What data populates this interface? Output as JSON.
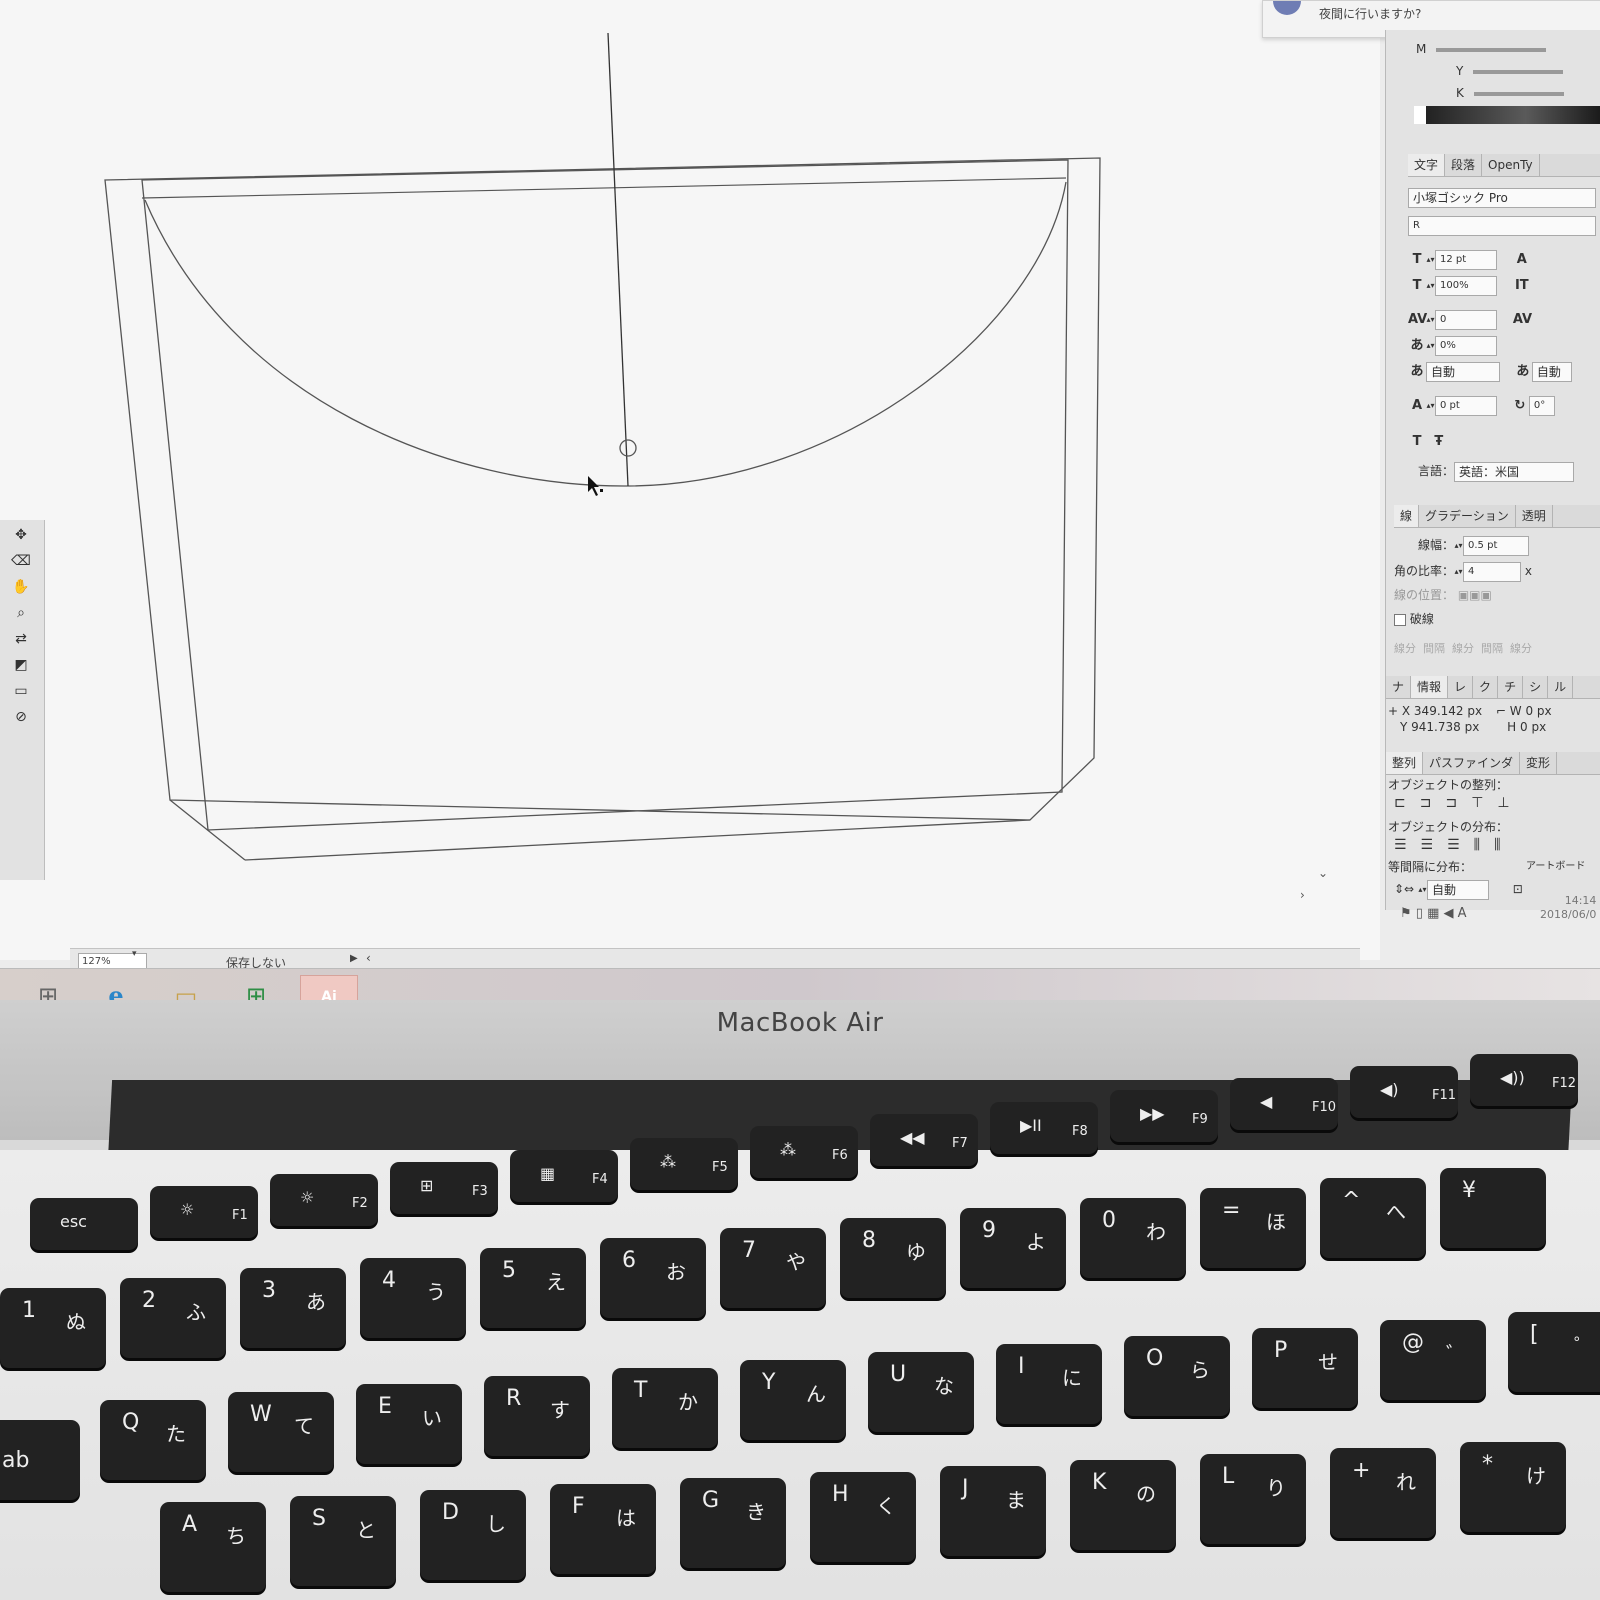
{
  "notification": {
    "text": "夜間に行いますか?"
  },
  "toolbox": {
    "icons": [
      "selection-icon",
      "hand-icon",
      "zoom-icon",
      "fill-stroke-icon"
    ]
  },
  "status_bar": {
    "zoom": "127%",
    "context": "保存しない"
  },
  "color_panel": {
    "channels": [
      "M",
      "Y",
      "K"
    ]
  },
  "character_panel": {
    "tabs": [
      "文字",
      "段落",
      "OpenTy"
    ],
    "font_family": "小塚ゴシック Pro",
    "font_style": "R",
    "font_size": "12 pt",
    "vertical_scale": "100%",
    "tracking": "0",
    "tsume": "0%",
    "aki": "自動",
    "aki_right": "自動",
    "baseline_shift": "0 pt",
    "rotation": "0°",
    "language_label": "言語：",
    "language_value": "英語：米国"
  },
  "stroke_panel": {
    "tabs": [
      "線",
      "グラデーション",
      "透明"
    ],
    "weight_label": "線幅：",
    "weight_value": "0.5 pt",
    "miter_label": "角の比率：",
    "miter_value": "4",
    "miter_unit": "x",
    "align_label": "線の位置：",
    "dashed_label": "破線",
    "dash_labels": [
      "線分",
      "間隔",
      "線分",
      "間隔",
      "線分"
    ]
  },
  "info_panel": {
    "tabs": [
      "ナ",
      "情報",
      "レ",
      "ク",
      "チ",
      "シ",
      "ル"
    ],
    "x": "349.142 px",
    "y": "941.738 px",
    "w": "0 px",
    "h": "0 px"
  },
  "align_panel": {
    "tabs": [
      "整列",
      "パスファインダ",
      "変形"
    ],
    "align_objects_label": "オブジェクトの整列：",
    "distribute_objects_label": "オブジェクトの分布：",
    "distribute_spacing_label": "等間隔に分布：",
    "align_to_label": "アートボード",
    "spacing_value": "自動"
  },
  "system_tray": {
    "time": "14:14",
    "date": "2018/06/0",
    "ime": "A"
  },
  "laptop": {
    "brand": "MacBook Air"
  },
  "keyboard": {
    "fn_row": [
      {
        "main": "esc",
        "sub": ""
      },
      {
        "main": "☼",
        "sub": "F1"
      },
      {
        "main": "☼",
        "sub": "F2"
      },
      {
        "main": "⊞",
        "sub": "F3"
      },
      {
        "main": "▦",
        "sub": "F4"
      },
      {
        "main": "⁂",
        "sub": "F5"
      },
      {
        "main": "⁂",
        "sub": "F6"
      },
      {
        "main": "◀◀",
        "sub": "F7"
      },
      {
        "main": "▶II",
        "sub": "F8"
      },
      {
        "main": "▶▶",
        "sub": "F9"
      },
      {
        "main": "◀",
        "sub": "F10"
      },
      {
        "main": "◀)",
        "sub": "F11"
      },
      {
        "main": "◀))",
        "sub": "F12"
      }
    ],
    "number_row": [
      {
        "main": "1",
        "kana": "ぬ"
      },
      {
        "main": "2",
        "kana": "ふ"
      },
      {
        "main": "3",
        "kana": "あ"
      },
      {
        "main": "4",
        "kana": "う"
      },
      {
        "main": "5",
        "kana": "え"
      },
      {
        "main": "6",
        "kana": "お"
      },
      {
        "main": "7",
        "kana": "や"
      },
      {
        "main": "8",
        "kana": "ゆ"
      },
      {
        "main": "9",
        "kana": "よ"
      },
      {
        "main": "0",
        "kana": "わ"
      },
      {
        "main": "=",
        "kana": "ほ"
      },
      {
        "main": "^",
        "kana": "へ"
      },
      {
        "main": "¥",
        "kana": ""
      }
    ],
    "qwerty_row": [
      {
        "main": "Q",
        "kana": "た"
      },
      {
        "main": "W",
        "kana": "て"
      },
      {
        "main": "E",
        "kana": "い"
      },
      {
        "main": "R",
        "kana": "す"
      },
      {
        "main": "T",
        "kana": "か"
      },
      {
        "main": "Y",
        "kana": "ん"
      },
      {
        "main": "U",
        "kana": "な"
      },
      {
        "main": "I",
        "kana": "に"
      },
      {
        "main": "O",
        "kana": "ら"
      },
      {
        "main": "P",
        "kana": "せ"
      },
      {
        "main": "@",
        "kana": "゛"
      },
      {
        "main": "[",
        "kana": "゜"
      }
    ],
    "home_row": [
      {
        "main": "A",
        "kana": "ち"
      },
      {
        "main": "S",
        "kana": "と"
      },
      {
        "main": "D",
        "kana": "し"
      },
      {
        "main": "F",
        "kana": "は"
      },
      {
        "main": "G",
        "kana": "き"
      },
      {
        "main": "H",
        "kana": "く"
      },
      {
        "main": "J",
        "kana": "ま"
      },
      {
        "main": "K",
        "kana": "の"
      },
      {
        "main": "L",
        "kana": "り"
      },
      {
        "main": "+",
        "kana": "れ"
      },
      {
        "main": "*",
        "kana": "け"
      }
    ],
    "tab_label": "ab"
  }
}
